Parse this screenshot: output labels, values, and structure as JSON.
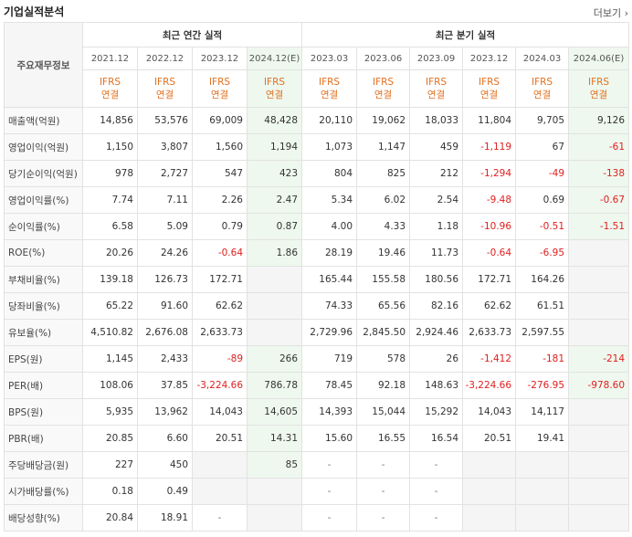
{
  "title": "기업실적분석",
  "more_label": "더보기",
  "more_arrow": "›",
  "label_header": "주요재무정보",
  "annual_group": "최근 연간 실적",
  "quarter_group": "최근 분기 실적",
  "columns": [
    "2021.12",
    "2022.12",
    "2023.12",
    "2024.12(E)",
    "2023.03",
    "2023.06",
    "2023.09",
    "2023.12",
    "2024.03",
    "2024.06(E)"
  ],
  "ifrs_line1": "IFRS",
  "ifrs_line2": "연결",
  "rows": [
    {
      "label": "매출액(억원)",
      "values": [
        "14,856",
        "53,576",
        "69,009",
        "48,428",
        "20,110",
        "19,062",
        "18,033",
        "11,804",
        "9,705",
        "9,126"
      ]
    },
    {
      "label": "영업이익(억원)",
      "values": [
        "1,150",
        "3,807",
        "1,560",
        "1,194",
        "1,073",
        "1,147",
        "459",
        "-1,119",
        "67",
        "-61"
      ]
    },
    {
      "label": "당기순이익(억원)",
      "values": [
        "978",
        "2,727",
        "547",
        "423",
        "804",
        "825",
        "212",
        "-1,294",
        "-49",
        "-138"
      ]
    },
    {
      "label": "영업이익률(%)",
      "values": [
        "7.74",
        "7.11",
        "2.26",
        "2.47",
        "5.34",
        "6.02",
        "2.54",
        "-9.48",
        "0.69",
        "-0.67"
      ]
    },
    {
      "label": "순이익률(%)",
      "values": [
        "6.58",
        "5.09",
        "0.79",
        "0.87",
        "4.00",
        "4.33",
        "1.18",
        "-10.96",
        "-0.51",
        "-1.51"
      ]
    },
    {
      "label": "ROE(%)",
      "values": [
        "20.26",
        "24.26",
        "-0.64",
        "1.86",
        "28.19",
        "19.46",
        "11.73",
        "-0.64",
        "-6.95",
        ""
      ]
    },
    {
      "label": "부채비율(%)",
      "values": [
        "139.18",
        "126.73",
        "172.71",
        "",
        "165.44",
        "155.58",
        "180.56",
        "172.71",
        "164.26",
        ""
      ]
    },
    {
      "label": "당좌비율(%)",
      "values": [
        "65.22",
        "91.60",
        "62.62",
        "",
        "74.33",
        "65.56",
        "82.16",
        "62.62",
        "61.51",
        ""
      ]
    },
    {
      "label": "유보율(%)",
      "values": [
        "4,510.82",
        "2,676.08",
        "2,633.73",
        "",
        "2,729.96",
        "2,845.50",
        "2,924.46",
        "2,633.73",
        "2,597.55",
        ""
      ]
    },
    {
      "label": "EPS(원)",
      "values": [
        "1,145",
        "2,433",
        "-89",
        "266",
        "719",
        "578",
        "26",
        "-1,412",
        "-181",
        "-214"
      ]
    },
    {
      "label": "PER(배)",
      "values": [
        "108.06",
        "37.85",
        "-3,224.66",
        "786.78",
        "78.45",
        "92.18",
        "148.63",
        "-3,224.66",
        "-276.95",
        "-978.60"
      ]
    },
    {
      "label": "BPS(원)",
      "values": [
        "5,935",
        "13,962",
        "14,043",
        "14,605",
        "14,393",
        "15,044",
        "15,292",
        "14,043",
        "14,117",
        ""
      ]
    },
    {
      "label": "PBR(배)",
      "values": [
        "20.85",
        "6.60",
        "20.51",
        "14.31",
        "15.60",
        "16.55",
        "16.54",
        "20.51",
        "19.41",
        ""
      ]
    },
    {
      "label": "주당배당금(원)",
      "values": [
        "227",
        "450",
        "",
        "85",
        "-",
        "-",
        "-",
        "",
        "",
        ""
      ]
    },
    {
      "label": "시가배당률(%)",
      "values": [
        "0.18",
        "0.49",
        "",
        "",
        "-",
        "-",
        "-",
        "",
        "",
        ""
      ]
    },
    {
      "label": "배당성향(%)",
      "values": [
        "20.84",
        "18.91",
        "-",
        "",
        "-",
        "-",
        "-",
        "",
        "",
        ""
      ]
    }
  ]
}
